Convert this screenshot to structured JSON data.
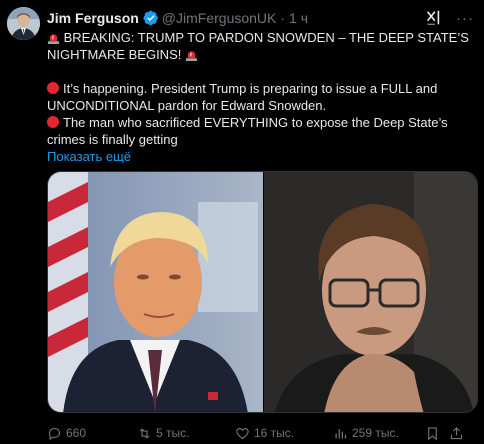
{
  "author": {
    "display_name": "Jim Ferguson",
    "handle": "@JimFergusonUK",
    "separator": "·",
    "time": "1 ч",
    "verified": true,
    "avatar_icon": "profile-photo"
  },
  "tweet": {
    "headline": "BREAKING: TRUMP TO PARDON SNOWDEN – THE DEEP STATE’S NIGHTMARE BEGINS!",
    "paragraph_1": "It’s happening. President Trump is preparing to issue a FULL and UNCONDITIONAL pardon for Edward Snowden.",
    "paragraph_2": "The man who sacrificed EVERYTHING to expose the Deep State’s crimes is finally getting",
    "show_more": "Показать ещё",
    "emoji": [
      "siren",
      "red-circle"
    ]
  },
  "media": {
    "count": 2,
    "left_icon": "photo-man-in-suit",
    "right_icon": "photo-man-with-glasses"
  },
  "actions": {
    "reply_count": "660",
    "retweet_count": "5 тыс.",
    "like_count": "16 тыс.",
    "view_count": "259 тыс."
  },
  "colors": {
    "background": "#000000",
    "text": "#e7e9ea",
    "secondary": "#71767b",
    "link": "#1d9bf0",
    "verified": "#1d9bf0",
    "alert_red": "#e0282e"
  }
}
